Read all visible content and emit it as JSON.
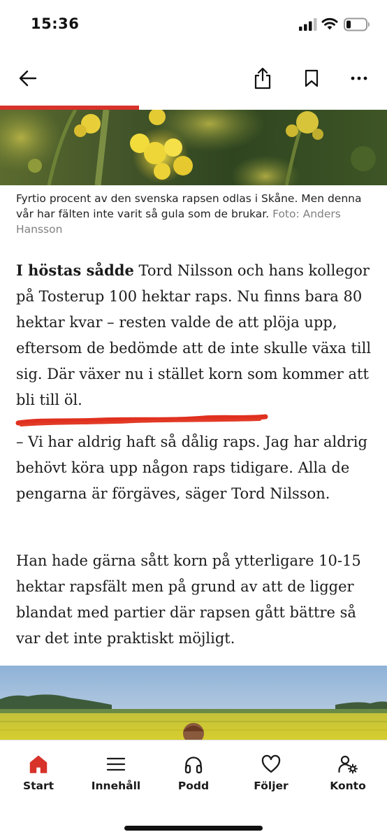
{
  "status_bar": {
    "time": "15:36",
    "icons": [
      "signal-icon",
      "wifi-icon",
      "battery-icon"
    ]
  },
  "toolbar": {
    "icons": [
      "back-arrow-icon",
      "share-icon",
      "bookmark-icon",
      "more-icon"
    ]
  },
  "reading_progress": {
    "fraction": 0.36,
    "color": "#d7332b"
  },
  "hero": {
    "caption": "Fyrtio procent av den svenska rapsen odlas i Skåne. Men denna vår har fälten inte varit så gula som de brukar.",
    "credit": "Foto: Anders Hansson"
  },
  "article": {
    "p1_lead": "I höstas sådde",
    "p1_text": "Tord Nilsson och hans kollegor på Tosterup 100 hektar raps. Nu finns bara 80 hektar kvar – resten valde de att plöja upp, eftersom de bedömde att de inte skulle växa till sig. Där växer nu i stället korn som kommer att bli till öl.",
    "p2": "– Vi har aldrig haft så dålig raps. Jag har aldrig behövt köra upp någon raps tidigare. Alla de pengarna är förgäves, säger Tord Nilsson.",
    "p3": "Han hade gärna sått korn på ytterligare 10-15 hektar rapsfält men på grund av att de ligger blandat med partier där rapsen gått bättre så var det inte praktiskt möjligt."
  },
  "bottom_nav": {
    "active_color": "#d7332b",
    "items": [
      {
        "label": "Start",
        "icon": "home-icon"
      },
      {
        "label": "Innehåll",
        "icon": "menu-icon"
      },
      {
        "label": "Podd",
        "icon": "headphones-icon"
      },
      {
        "label": "Följer",
        "icon": "heart-icon"
      },
      {
        "label": "Konto",
        "icon": "account-settings-icon"
      }
    ]
  }
}
